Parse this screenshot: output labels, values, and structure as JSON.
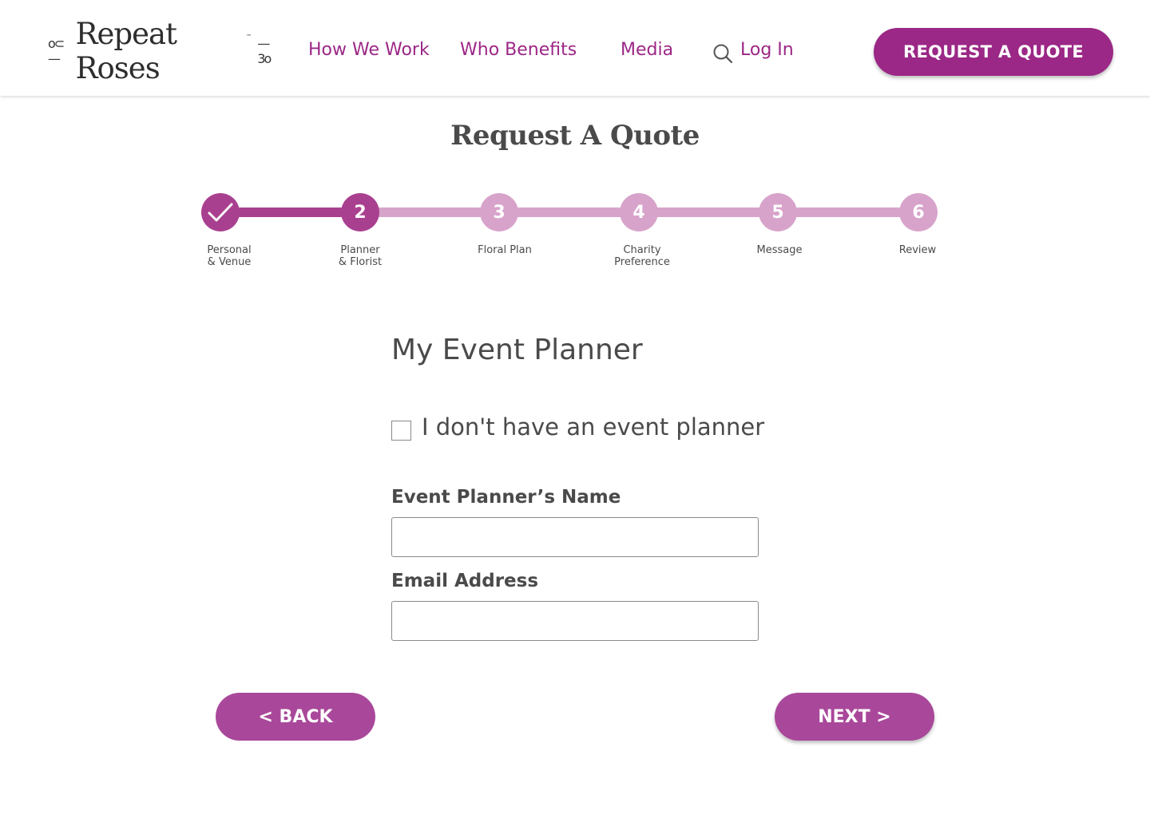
{
  "header": {
    "logo_text": "Repeat Roses",
    "logo_tm": "™",
    "nav": [
      {
        "label": "How We Work"
      },
      {
        "label": "Who Benefits"
      },
      {
        "label": "Media"
      },
      {
        "label": "Log In"
      }
    ],
    "cta_label": "REQUEST A QUOTE",
    "brand_color": "#9b2786"
  },
  "page": {
    "title": "Request A Quote"
  },
  "stepper": {
    "current_step": 2,
    "steps": [
      {
        "number": "1",
        "label": "Personal\n& Venue",
        "status": "done"
      },
      {
        "number": "2",
        "label": "Planner\n& Florist",
        "status": "active"
      },
      {
        "number": "3",
        "label": "Floral Plan",
        "status": "todo"
      },
      {
        "number": "4",
        "label": "Charity\nPreference",
        "status": "todo"
      },
      {
        "number": "5",
        "label": "Message",
        "status": "todo"
      },
      {
        "number": "6",
        "label": "Review",
        "status": "todo"
      }
    ],
    "colors": {
      "done": "#a9408f",
      "todo": "#d8a3cb"
    }
  },
  "form": {
    "section_title": "My Event Planner",
    "no_planner_label": "I don't have an event planner",
    "no_planner_checked": false,
    "fields": [
      {
        "label": "Event Planner’s Name",
        "value": "",
        "placeholder": ""
      },
      {
        "label": "Email Address",
        "value": "",
        "placeholder": ""
      }
    ]
  },
  "buttons": {
    "back_label": "< BACK",
    "next_label": "NEXT >"
  }
}
